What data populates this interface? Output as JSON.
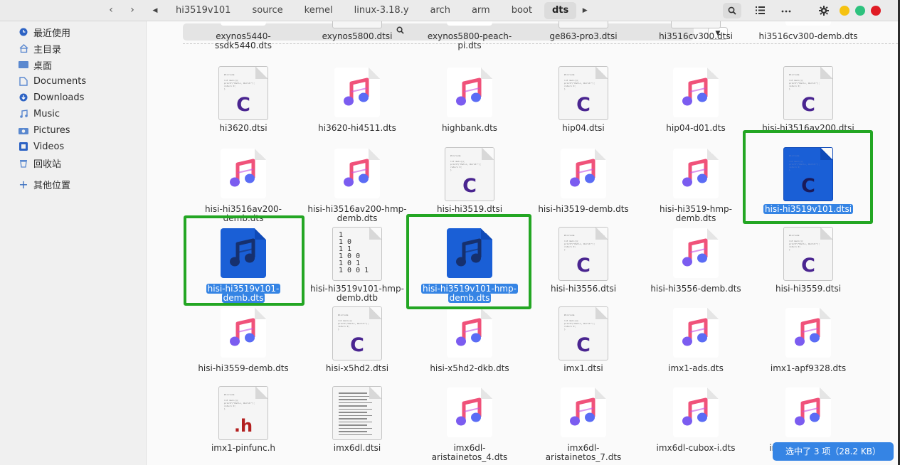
{
  "header": {
    "back_icon": "‹",
    "forward_icon": "›",
    "left_arrow": "◀",
    "right_arrow": "▶",
    "crumbs": [
      "hi3519v101",
      "source",
      "kernel",
      "linux-3.18.y",
      "arch",
      "arm",
      "boot",
      "dts"
    ]
  },
  "sidebar": {
    "items": [
      {
        "label": "最近使用"
      },
      {
        "label": "主目录"
      },
      {
        "label": "桌面"
      },
      {
        "label": "Documents"
      },
      {
        "label": "Downloads"
      },
      {
        "label": "Music"
      },
      {
        "label": "Pictures"
      },
      {
        "label": "Videos"
      },
      {
        "label": "回收站"
      },
      {
        "label": "其他位置"
      }
    ]
  },
  "search": {
    "placeholder": ""
  },
  "files": {
    "row0": [
      "exynos5440-ssdk5440.dts",
      "exynos5800.dtsi",
      "exynos5800-peach-pi.dts",
      "ge863-pro3.dtsi",
      "hi3516cv300.dtsi",
      "hi3516cv300-demb.dts"
    ],
    "row1": [
      "hi3620.dtsi",
      "hi3620-hi4511.dts",
      "highbank.dts",
      "hip04.dtsi",
      "hip04-d01.dts",
      "hisi-hi3516av200.dtsi"
    ],
    "row2": [
      "hisi-hi3516av200-demb.dts",
      "hisi-hi3516av200-hmp-demb.dts",
      "hisi-hi3519.dtsi",
      "hisi-hi3519-demb.dts",
      "hisi-hi3519-hmp-demb.dts",
      "hisi-hi3519v101.dtsi"
    ],
    "row3": [
      "hisi-hi3519v101-demb.dts",
      "hisi-hi3519v101-hmp-demb.dtb",
      "hisi-hi3519v101-hmp-demb.dts",
      "hisi-hi3556.dtsi",
      "hisi-hi3556-demb.dts",
      "hisi-hi3559.dtsi"
    ],
    "row4": [
      "hisi-hi3559-demb.dts",
      "hisi-x5hd2.dtsi",
      "hisi-x5hd2-dkb.dts",
      "imx1.dtsi",
      "imx1-ads.dts",
      "imx1-apf9328.dts"
    ],
    "row5": [
      "imx1-pinfunc.h",
      "imx6dl.dtsi",
      "imx6dl-aristainetos_4.dts",
      "imx6dl-aristainetos_7.dts",
      "imx6dl-cubox-i.dts",
      "imx6dl-dfi-fs700..."
    ]
  },
  "icon_letters": {
    "c": "C",
    "h": ".h"
  },
  "binary_digits": "1\n1 0\n1 1\n1 0 0\n1 0 1\n1 0 0 1",
  "code_lines": "#include <stdio.h>\n\nint main(){\n  printf(\"Hello, World!\");\n  return 0;\n}",
  "status": {
    "text": "选中了 3 项（28.2 KB）"
  },
  "colors": {
    "selection": "#3584e4",
    "annotation": "#23a623"
  }
}
